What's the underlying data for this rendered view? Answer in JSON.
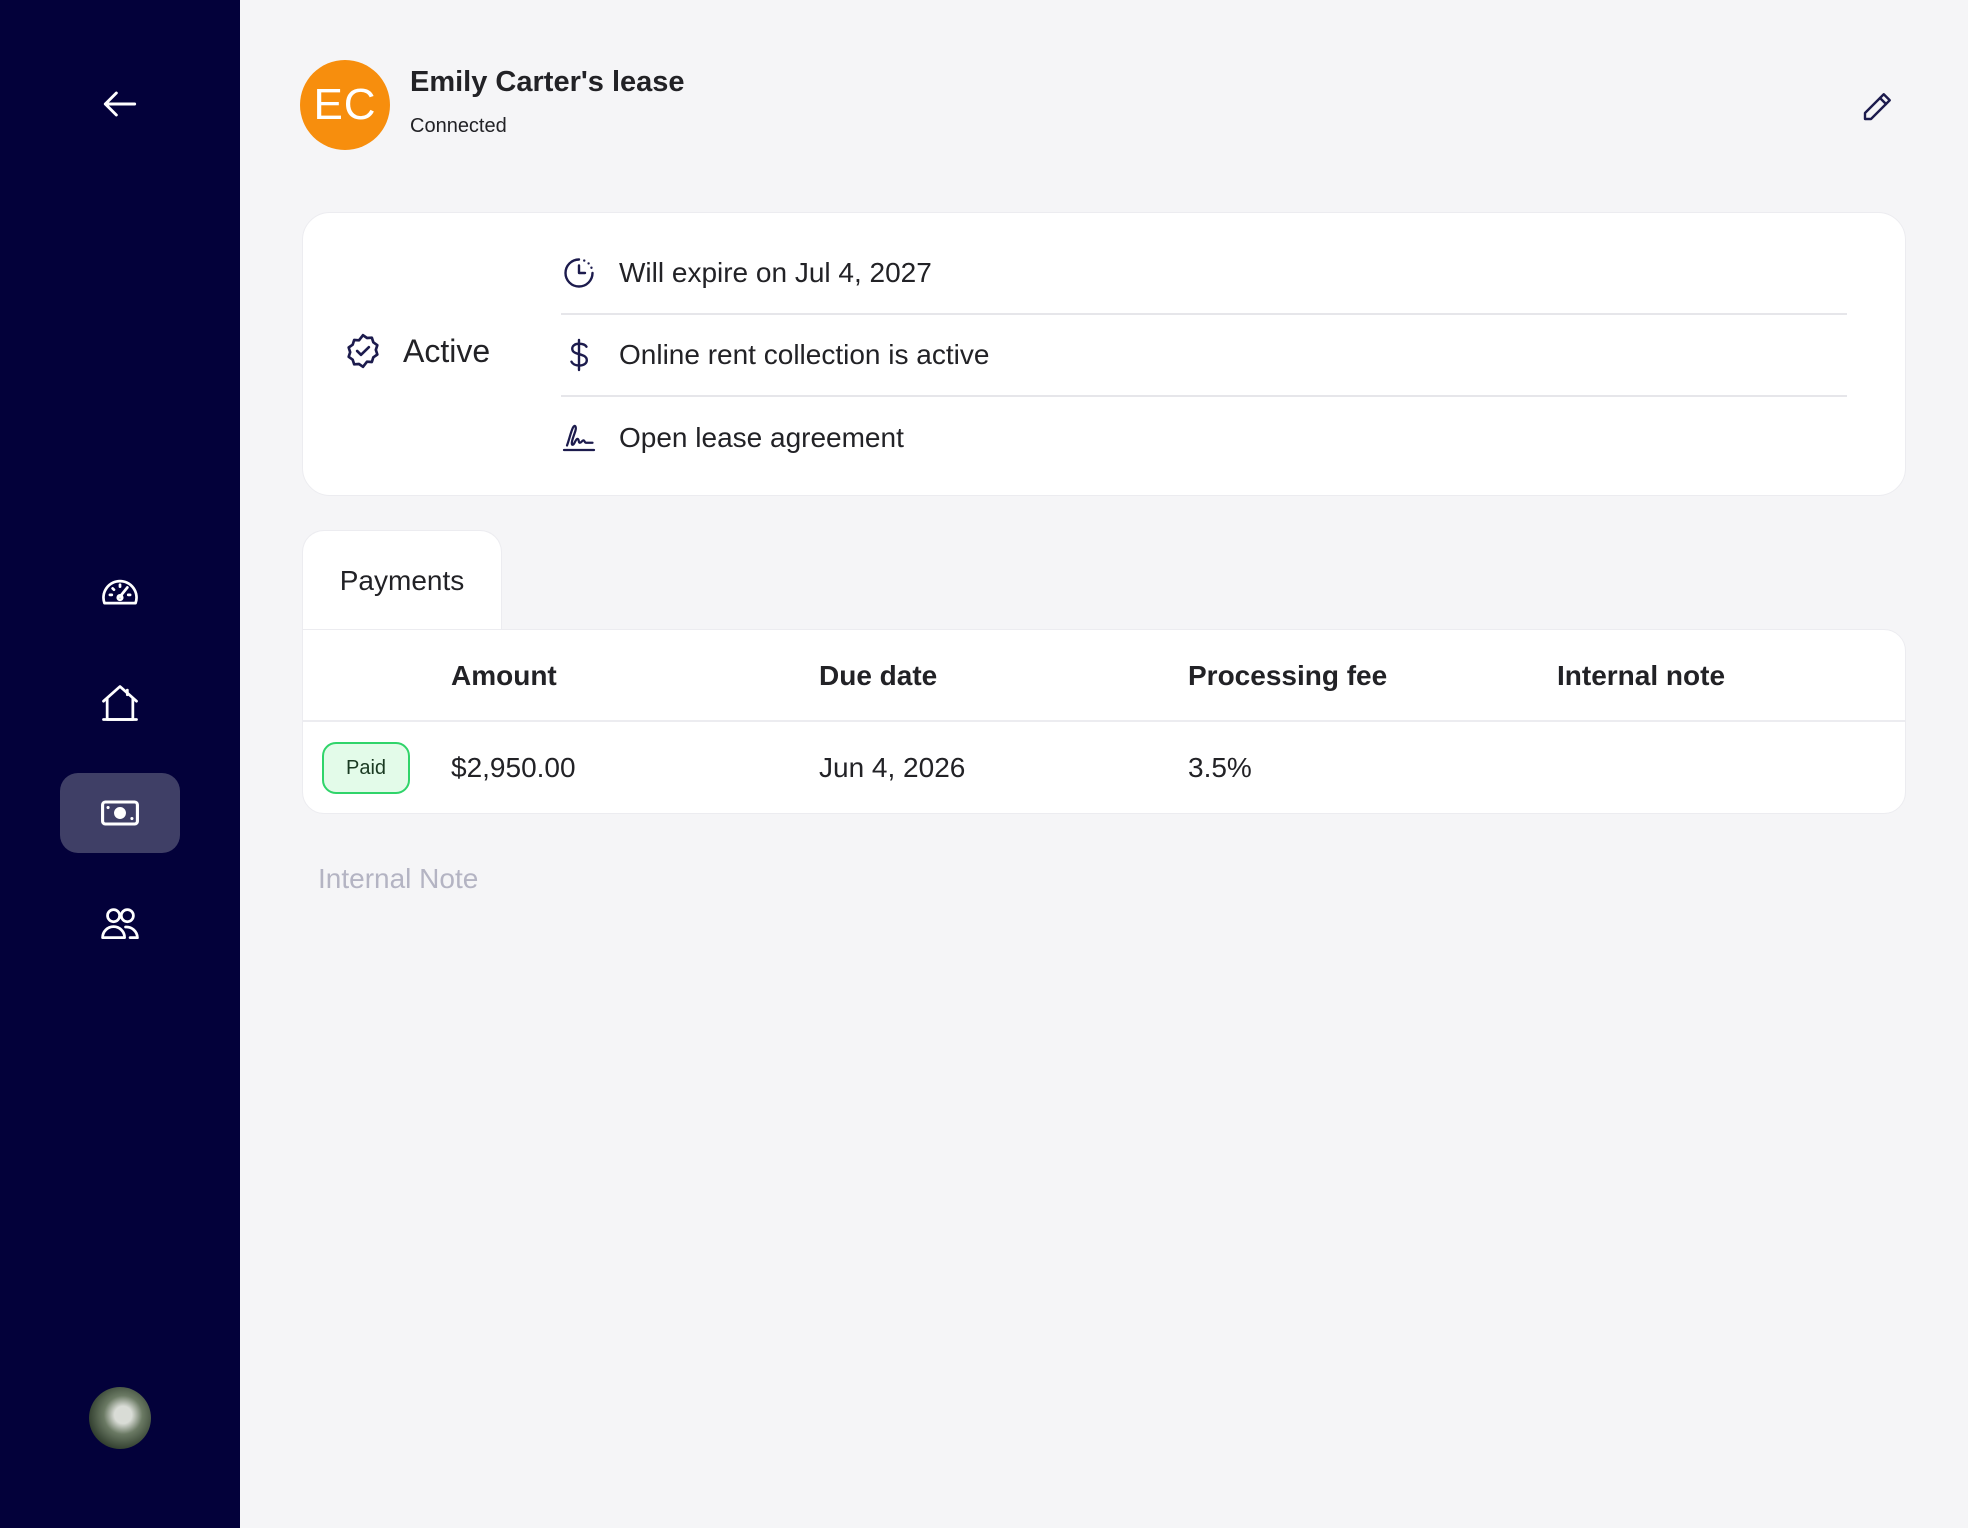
{
  "sidebar": {
    "items": [
      {
        "name": "dashboard",
        "icon": "speedometer-icon"
      },
      {
        "name": "properties",
        "icon": "house-icon"
      },
      {
        "name": "payments",
        "icon": "banknote-icon",
        "active": true
      },
      {
        "name": "tenants",
        "icon": "users-icon"
      }
    ],
    "back_icon": "arrow-left-icon"
  },
  "header": {
    "initials": "EC",
    "title": "Emily Carter's lease",
    "status": "Connected",
    "avatar_color": "#f78e0d"
  },
  "summary": {
    "status_label": "Active",
    "rows": [
      {
        "icon": "clock-icon",
        "text": "Will expire on Jul 4, 2027"
      },
      {
        "icon": "dollar-icon",
        "text": "Online rent collection is active"
      },
      {
        "icon": "signature-icon",
        "text": "Open lease agreement"
      }
    ]
  },
  "tabs": [
    {
      "label": "Payments",
      "active": true
    }
  ],
  "payments_table": {
    "columns": [
      "Amount",
      "Due date",
      "Processing fee",
      "Internal note"
    ],
    "rows": [
      {
        "status": "Paid",
        "amount": "$2,950.00",
        "due_date": "Jun 4, 2026",
        "processing_fee": "3.5%",
        "internal_note": ""
      }
    ]
  },
  "internal_note": {
    "placeholder": "Internal Note",
    "value": ""
  },
  "colors": {
    "sidebar_bg": "#03013a",
    "active_nav_bg": "#3f3f66",
    "paid_border": "#30d46a",
    "paid_bg": "#e3fbe9"
  }
}
